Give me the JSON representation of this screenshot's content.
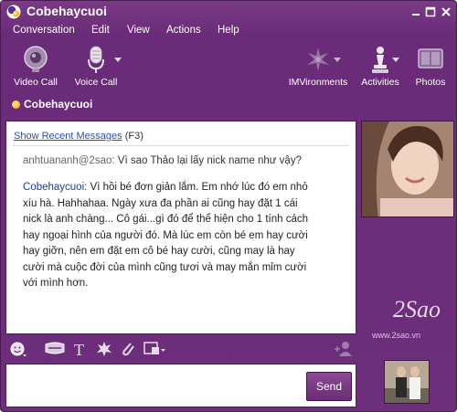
{
  "window": {
    "title": "Cobehaycuoi",
    "accent": "#6d2f7b"
  },
  "menu": {
    "items": [
      "Conversation",
      "Edit",
      "View",
      "Actions",
      "Help"
    ]
  },
  "toolbar": {
    "video_call": "Video Call",
    "voice_call": "Voice Call",
    "imvironments": "IMVironments",
    "activities": "Activities",
    "photos": "Photos"
  },
  "contact": {
    "name": "Cobehaycuoi",
    "status_color": "#f0a81c"
  },
  "conversation": {
    "recent_link": "Show Recent Messages",
    "recent_shortcut": "(F3)",
    "messages": [
      {
        "sender": "anhtuananh@2sao:",
        "text": "Vì sao Thảo lại lấy nick name như vậy?"
      },
      {
        "sender": "Cobehaycuoi:",
        "lines": [
          "Vì hồi bé đơn giản lắm. Em nhớ lúc đó em nhỏ",
          "xíu hà. Hahhahaa. Ngày xưa đa phần ai cũng hay đặt 1 cái",
          "nick là anh chàng... Cô gái...gì đó để thể hiện cho 1 tính cách",
          "hay ngoại hình của người đó. Mà lúc em còn bé em hay cười",
          "hay giỡn, nên em đặt em cô bé hay cười, cũng may là hay",
          "cười mà cuộc đời của mình cũng tươi và may mắn mỉm cười",
          "với mình hơn."
        ]
      }
    ]
  },
  "composer": {
    "send_label": "Send"
  },
  "watermark": {
    "logo": "2Sao",
    "url": "www.2sao.vn"
  },
  "icons": [
    "yahoo-logo-icon",
    "minimize-icon",
    "maximize-icon",
    "close-icon",
    "webcam-icon",
    "microphone-icon",
    "imvironments-icon",
    "chess-piece-icon",
    "photos-icon",
    "smiley-icon",
    "buzz-icon",
    "text-format-icon",
    "audible-icon",
    "attach-icon",
    "share-icon",
    "add-contact-icon"
  ]
}
